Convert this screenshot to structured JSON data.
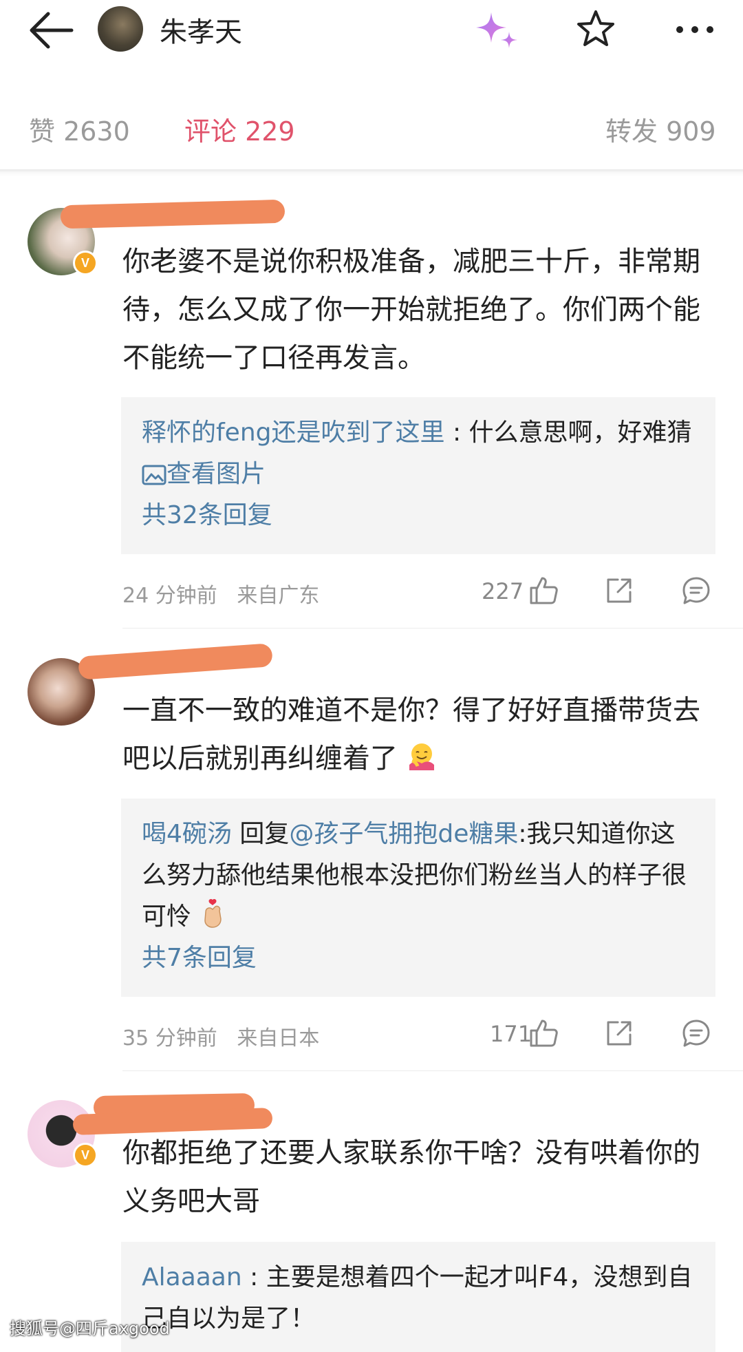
{
  "header": {
    "user_name": "朱孝天",
    "icons": [
      "back-arrow-icon",
      "sparkle-icon",
      "star-icon",
      "more-icon"
    ]
  },
  "tabs": [
    {
      "label": "赞 2630"
    },
    {
      "label": "评论 229"
    },
    {
      "label": "转发 909"
    }
  ],
  "comments": [
    {
      "name_peek": "",
      "text": "你老婆不是说你积极准备，减肥三十斤，非常期待，怎么又成了你一开始就拒绝了。你们两个能不能统一了口径再发言。",
      "reply": {
        "user": "释怀的feng还是吹到了这里",
        "sep": " : ",
        "text": "什么意思啊，好难猜",
        "link": "查看图片",
        "count": "共32条回复"
      },
      "time": "24 分钟前",
      "location": "来自广东",
      "likes": "227"
    },
    {
      "name_peek": "",
      "text": "一直不一致的难道不是你？得了好好直播带货去吧以后就别再纠缠着了",
      "reply": {
        "user": "喝4碗汤",
        "sep": " 回复",
        "mention": "@孩子气拥抱de糖果",
        "text": ":我只知道你这么努力舔他结果他根本没把你们粉丝当人的样子很可怜",
        "count": "共7条回复"
      },
      "time": "35 分钟前",
      "location": "来自日本",
      "likes": "171"
    },
    {
      "text": "你都拒绝了还要人家联系你干啥？没有哄着你的义务吧大哥",
      "reply": {
        "user": "Alaaaan",
        "sep": " : ",
        "text": "主要是想着四个一起才叫F4，没想到自己自以为是了！"
      }
    }
  ],
  "watermark": "搜狐号@四斤axgood",
  "colors": {
    "accent": "#e0536b",
    "link": "#4e7ea6",
    "redaction": "#f08a5d",
    "vip": "#f5a623"
  }
}
